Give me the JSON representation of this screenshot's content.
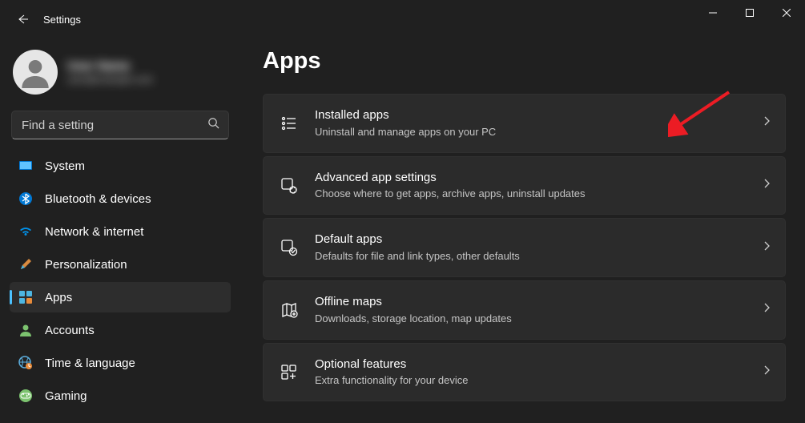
{
  "window": {
    "title": "Settings"
  },
  "profile": {
    "name": "User Name",
    "email": "user@example.com"
  },
  "search": {
    "placeholder": "Find a setting"
  },
  "sidebar": {
    "items": [
      {
        "label": "System"
      },
      {
        "label": "Bluetooth & devices"
      },
      {
        "label": "Network & internet"
      },
      {
        "label": "Personalization"
      },
      {
        "label": "Apps"
      },
      {
        "label": "Accounts"
      },
      {
        "label": "Time & language"
      },
      {
        "label": "Gaming"
      }
    ]
  },
  "main": {
    "title": "Apps",
    "cards": [
      {
        "title": "Installed apps",
        "desc": "Uninstall and manage apps on your PC"
      },
      {
        "title": "Advanced app settings",
        "desc": "Choose where to get apps, archive apps, uninstall updates"
      },
      {
        "title": "Default apps",
        "desc": "Defaults for file and link types, other defaults"
      },
      {
        "title": "Offline maps",
        "desc": "Downloads, storage location, map updates"
      },
      {
        "title": "Optional features",
        "desc": "Extra functionality for your device"
      }
    ]
  }
}
